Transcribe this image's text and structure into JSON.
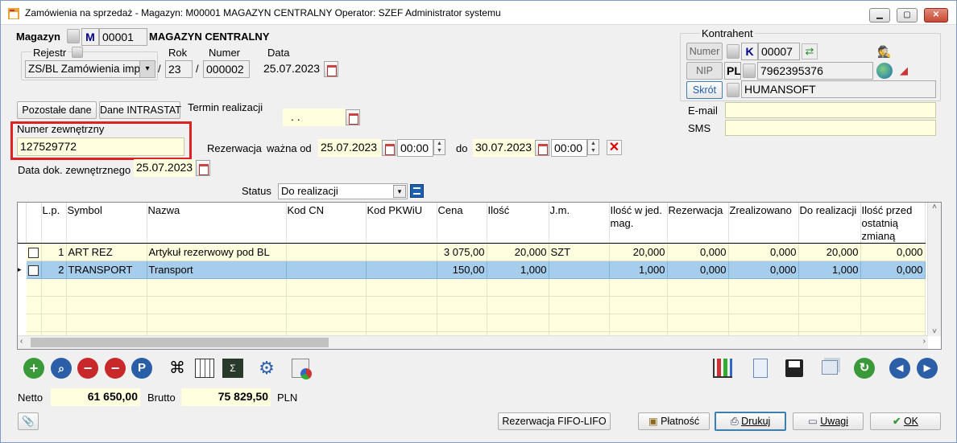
{
  "window": {
    "title": "Zamówienia na sprzedaż - Magazyn: M00001 MAGAZYN CENTRALNY  Operator: SZEF Administrator systemu"
  },
  "magazyn": {
    "label": "Magazyn",
    "type": "M",
    "code": "00001",
    "name": "MAGAZYN CENTRALNY"
  },
  "rejestr": {
    "label": "Rejestr",
    "value": "ZS/BL Zamówienia imp"
  },
  "rok": {
    "label": "Rok",
    "value": "23"
  },
  "numer": {
    "label": "Numer",
    "value": "000002"
  },
  "data": {
    "label": "Data",
    "value": "25.07.2023"
  },
  "sep": "/",
  "buttons": {
    "pozostale": "Pozostałe dane",
    "intrastat": "Dane INTRASTAT"
  },
  "termin": {
    "label": "Termin realizacji",
    "value": ". ."
  },
  "numer_zew": {
    "label": "Numer zewnętrzny",
    "value": "127529772"
  },
  "data_dok": {
    "label": "Data dok. zewnętrznego",
    "value": "25.07.2023"
  },
  "rezerwacja": {
    "label": "Rezerwacja",
    "od_label": "ważna od",
    "od_date": "25.07.2023",
    "od_time": "00:00",
    "do_label": "do",
    "do_date": "30.07.2023",
    "do_time": "00:00"
  },
  "status": {
    "label": "Status",
    "value": "Do realizacji"
  },
  "kontrahent": {
    "title": "Kontrahent",
    "numer_label": "Numer",
    "type": "K",
    "numer": "00007",
    "nip_label": "NIP",
    "country": "PL",
    "nip": "7962395376",
    "skrot_label": "Skrót",
    "skrot": "HUMANSOFT",
    "email_label": "E-mail",
    "email": "",
    "sms_label": "SMS",
    "sms": ""
  },
  "grid": {
    "columns": [
      "",
      "L.p.",
      "Symbol",
      "Nazwa",
      "Kod CN",
      "Kod PKWiU",
      "Cena",
      "Ilość",
      "J.m.",
      "Ilość w jed. mag.",
      "Rezerwacja",
      "Zrealizowano",
      "Do realizacji",
      "Ilość przed ostatnią zmianą"
    ],
    "rows": [
      {
        "lp": "1",
        "symbol": "ART REZ",
        "nazwa": "Artykuł rezerwowy pod BL",
        "kodcn": "",
        "pkwiu": "",
        "cena": "3 075,00",
        "ilosc": "20,000",
        "jm": "SZT",
        "ilmag": "20,000",
        "rez": "0,000",
        "zreal": "0,000",
        "doreal": "20,000",
        "przed": "0,000"
      },
      {
        "lp": "2",
        "symbol": "TRANSPORT",
        "nazwa": "Transport",
        "kodcn": "",
        "pkwiu": "",
        "cena": "150,00",
        "ilosc": "1,000",
        "jm": "",
        "ilmag": "1,000",
        "rez": "0,000",
        "zreal": "0,000",
        "doreal": "1,000",
        "przed": "0,000"
      }
    ]
  },
  "totals": {
    "netto_label": "Netto",
    "netto": "61 650,00",
    "brutto_label": "Brutto",
    "brutto": "75 829,50",
    "currency": "PLN"
  },
  "bottom": {
    "fifo": "Rezerwacja FIFO-LIFO",
    "platnosc": "Płatność",
    "drukuj": "Drukuj",
    "uwagi": "Uwagi",
    "ok": "OK"
  }
}
